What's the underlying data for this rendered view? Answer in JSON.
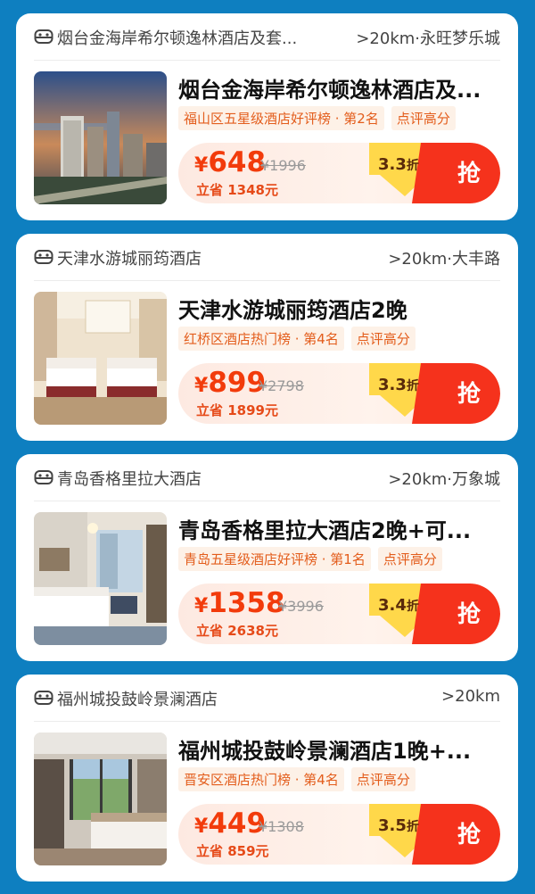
{
  "cards": [
    {
      "header_name": "烟台金海岸希尔顿逸林酒店及套...",
      "header_distance": ">20km·永旺梦乐城",
      "title": "烟台金海岸希尔顿逸林酒店及...",
      "rank_tag": "福山区五星级酒店好评榜 · 第2名",
      "review_tag": "点评高分",
      "currency": "¥",
      "price": "648",
      "original_price": "¥1996",
      "savings": "立省 1348元",
      "discount_value": "3.3",
      "discount_unit": "折",
      "grab_label": "抢",
      "image": "hotel-exterior-skyline"
    },
    {
      "header_name": "天津水游城丽筠酒店",
      "header_distance": ">20km·大丰路",
      "title": "天津水游城丽筠酒店2晚",
      "rank_tag": "红桥区酒店热门榜 · 第4名",
      "review_tag": "点评高分",
      "currency": "¥",
      "price": "899",
      "original_price": "¥2798",
      "savings": "立省 1899元",
      "discount_value": "3.3",
      "discount_unit": "折",
      "grab_label": "抢",
      "image": "twin-bed-room"
    },
    {
      "header_name": "青岛香格里拉大酒店",
      "header_distance": ">20km·万象城",
      "title": "青岛香格里拉大酒店2晚+可...",
      "rank_tag": "青岛五星级酒店好评榜 · 第1名",
      "review_tag": "点评高分",
      "currency": "¥",
      "price": "1358",
      "original_price": "¥3996",
      "savings": "立省 2638元",
      "discount_value": "3.4",
      "discount_unit": "折",
      "grab_label": "抢",
      "image": "king-bed-room-window"
    },
    {
      "header_name": "福州城投鼓岭景澜酒店",
      "header_distance": ">20km",
      "title": "福州城投鼓岭景澜酒店1晚+...",
      "rank_tag": "晋安区酒店热门榜 · 第4名",
      "review_tag": "点评高分",
      "currency": "¥",
      "price": "449",
      "original_price": "¥1308",
      "savings": "立省 859元",
      "discount_value": "3.5",
      "discount_unit": "折",
      "grab_label": "抢",
      "image": "room-with-garden-view"
    }
  ],
  "colors": {
    "page_background": "#0e7fc0",
    "price_red": "#f23b0b",
    "grab_red": "#f5321c",
    "discount_yellow": "#ffd84a",
    "tag_text": "#e35d1c",
    "tag_background": "#fdf1e7"
  }
}
